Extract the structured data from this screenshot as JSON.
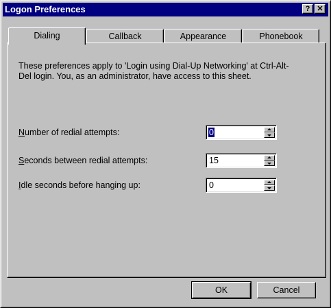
{
  "window": {
    "title": "Logon Preferences",
    "help_glyph": "?",
    "close_glyph": "✕"
  },
  "tabs": [
    {
      "label": "Dialing",
      "active": true
    },
    {
      "label": "Callback",
      "active": false
    },
    {
      "label": "Appearance",
      "active": false
    },
    {
      "label": "Phonebook",
      "active": false
    }
  ],
  "dialing": {
    "description": "These preferences apply to 'Login using Dial-Up Networking' at Ctrl-Alt-Del login.  You, as an administrator, have access to this sheet.",
    "fields": [
      {
        "mnemonic": "N",
        "label_rest": "umber of redial attempts:",
        "value": "0"
      },
      {
        "mnemonic": "S",
        "label_rest": "econds between redial attempts:",
        "value": "15"
      },
      {
        "mnemonic": "I",
        "label_rest": "dle seconds before hanging up:",
        "value": "0"
      }
    ]
  },
  "buttons": {
    "ok": "OK",
    "cancel": "Cancel"
  }
}
